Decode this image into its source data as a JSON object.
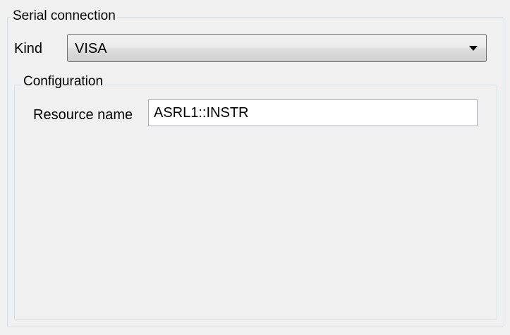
{
  "serial_connection": {
    "title": "Serial connection",
    "kind_label": "Kind",
    "kind_value": "VISA",
    "kind_dropdown_icon": "chevron-down-icon"
  },
  "configuration": {
    "title": "Configuration",
    "resource_name_label": "Resource name",
    "resource_name_value": "ASRL1::INSTR"
  }
}
